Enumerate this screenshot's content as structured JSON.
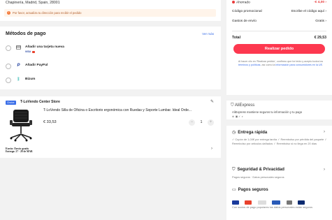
{
  "address": {
    "line": "Chapinería, Madrid, Spain, 28001",
    "warning": "Por favor, actualiza tu dirección para recibir el pedido"
  },
  "payment": {
    "title": "Métodos de pago",
    "more": "Ver más",
    "methods": [
      {
        "label": "Añadir una tarjeta nueva",
        "logos": "VISA"
      },
      {
        "label": "Añadir PayPal"
      },
      {
        "label": "Bizum"
      }
    ]
  },
  "store": {
    "badge": "Choice",
    "name": "T-LoVendo Center Store",
    "product_title": "T-LoVendo Silla de Oficina o Escritorio ergonómica con Ruedas y Soporte Lumbar. Ideal Orde...",
    "price": "€ 33,53",
    "quantity": "1",
    "shipping": "Envío: Envío gratis",
    "delivery": "Entrega: 27 - 28 de MAR"
  },
  "summary": {
    "saved_label": "Ahorrado",
    "saved_value": "-€ 4,00",
    "promo_label": "Código promocional",
    "promo_value": "Escribe el código aquí",
    "shipping_label": "Gastos de envío",
    "shipping_value": "Gratis",
    "total_label": "Total",
    "total_value": "€ 29,53",
    "order_button": "Realizar pedido",
    "legal_1": "Al hacer clic en 'Realizar pedido', confirmo que he leído y acepto todos los ",
    "legal_link_1": "términos y políticas",
    "legal_2": ", así como la ",
    "legal_link_2": "información para consumidores en la UE",
    "legal_3": "."
  },
  "ali": {
    "title": "AliExpress",
    "desc": "AliExpress mantiene seguros tu información y tu pago"
  },
  "entrega": {
    "title": "Entrega rápida",
    "body": "✓ Cupón de 1,00€ por entrega tardía  ✓ Reembolso por pérdida del paquete  ✓ Reembolso por artículos dañados  ✓ Reembolso si no llega en 20 días"
  },
  "seguridad": {
    "title": "Seguridad & Privacidad",
    "body": "Pagos seguros · Datos personales seguros"
  },
  "pagos": {
    "title": "Pagos seguros",
    "body": "Con socios de pago populares tus datos personales están seguros"
  },
  "colors": {
    "accent": "#fd384f",
    "link": "#3a6ee8",
    "warning": "#f47a3b"
  }
}
